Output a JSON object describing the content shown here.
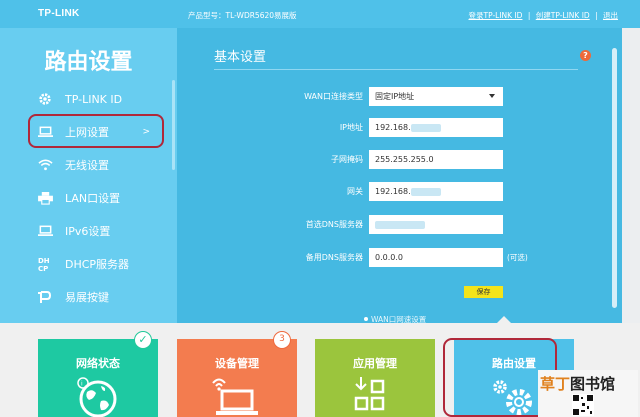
{
  "header": {
    "brand": "TP-LINK",
    "model": "产品型号：TL-WDR5620易展版",
    "login_link": "登录TP-LINK ID",
    "create_link": "创建TP-LINK ID",
    "exit_link": "退出",
    "separator": "|"
  },
  "sidebar": {
    "title": "路由设置",
    "items": [
      {
        "label": "TP-LINK ID",
        "icon": "gear-icon"
      },
      {
        "label": "上网设置",
        "icon": "laptop-icon",
        "arrow": ">"
      },
      {
        "label": "无线设置",
        "icon": "wifi-icon"
      },
      {
        "label": "LAN口设置",
        "icon": "printer-icon"
      },
      {
        "label": "IPv6设置",
        "icon": "laptop-icon"
      },
      {
        "label": "DHCP服务器",
        "icon": "dhcp-icon"
      },
      {
        "label": "易展按键",
        "icon": "mesh-button-icon"
      }
    ]
  },
  "main": {
    "title": "基本设置",
    "help_icon": "?",
    "fields": [
      {
        "label": "WAN口连接类型",
        "value": "固定IP地址"
      },
      {
        "label": "IP地址",
        "value": "192.168."
      },
      {
        "label": "子网掩码",
        "value": "255.255.255.0"
      },
      {
        "label": "网关",
        "value": "192.168."
      },
      {
        "label": "首选DNS服务器",
        "value": ""
      },
      {
        "label": "备用DNS服务器",
        "value": "0.0.0.0",
        "note": "(可选)"
      }
    ],
    "save_label": "保存",
    "cut_text": "WAN口网速设置"
  },
  "bottom": {
    "tiles": [
      {
        "label": "网络状态",
        "color": "#1ec9a2",
        "badge": "✓",
        "icon": "globe-icon"
      },
      {
        "label": "设备管理",
        "color": "#f37c4f",
        "badge": "3",
        "icon": "laptop-wifi-icon"
      },
      {
        "label": "应用管理",
        "color": "#9bc53d",
        "icon": "apps-icon"
      },
      {
        "label": "路由设置",
        "color": "#4fc1e9",
        "icon": "gears-icon"
      }
    ]
  },
  "watermark": {
    "text1": "草丁",
    "text2": "图书馆"
  },
  "colors": {
    "header": "#4fc1e9",
    "sidebar": "#68cdf0",
    "main": "#45b9e2",
    "save_button": "#f4e41a",
    "highlight": "#b0283a"
  }
}
